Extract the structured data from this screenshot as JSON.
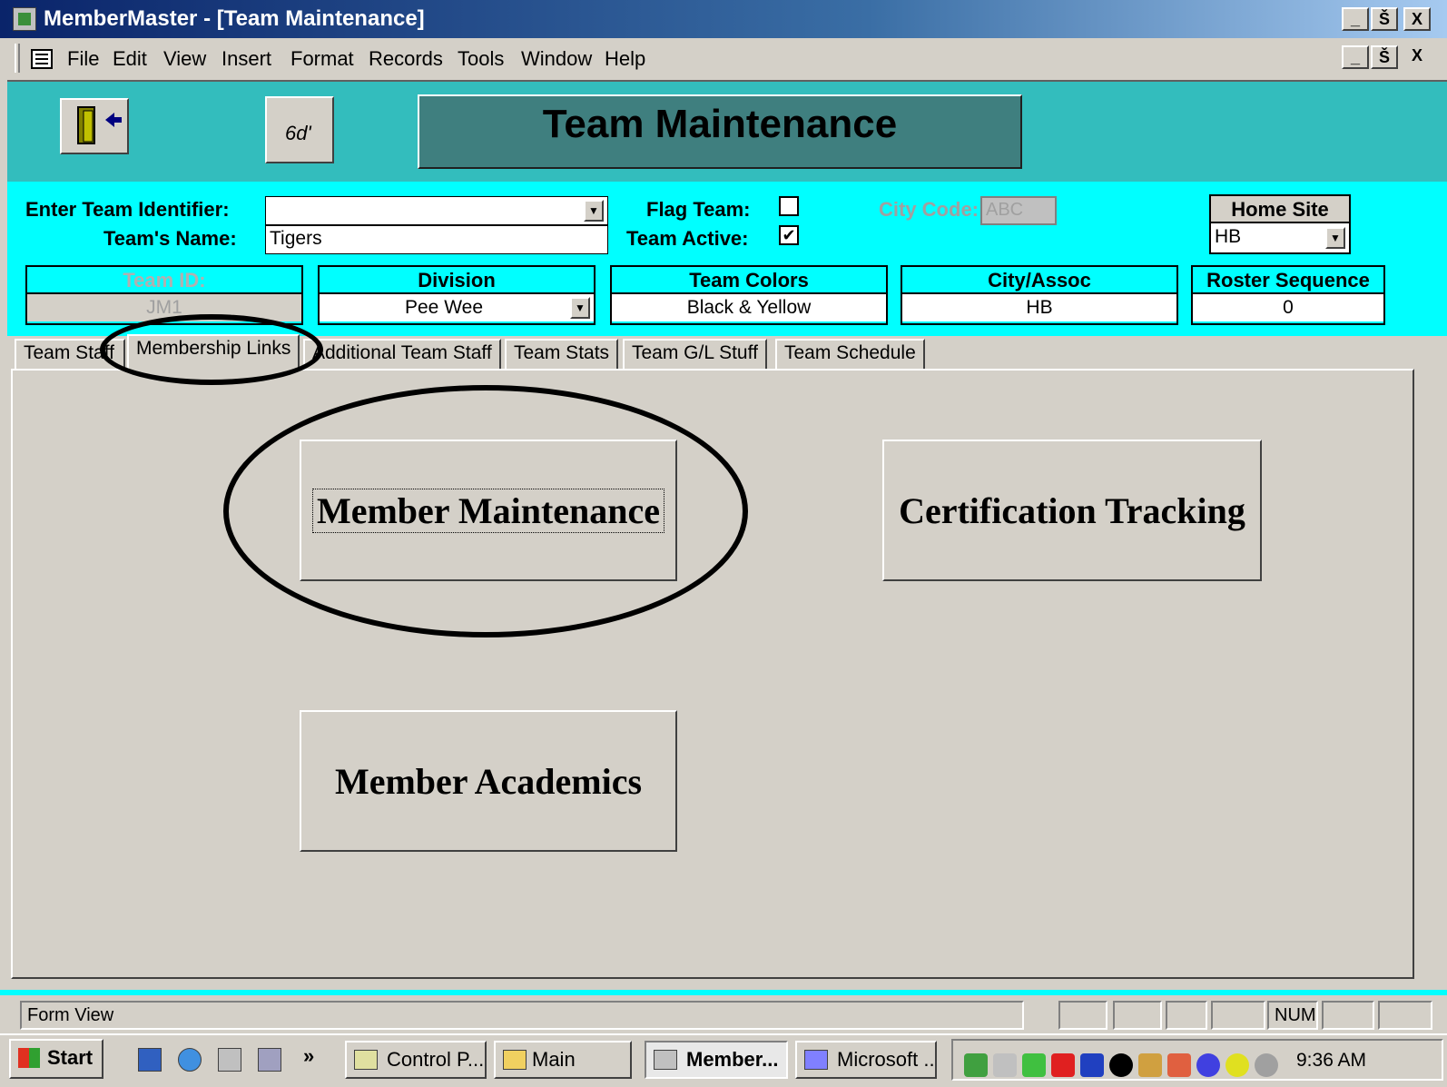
{
  "window": {
    "title": "MemberMaster - [Team Maintenance]",
    "controls": [
      "_",
      "Š",
      "X"
    ]
  },
  "menu": {
    "items": [
      "File",
      "Edit",
      "View",
      "Insert",
      "Format",
      "Records",
      "Tools",
      "Window",
      "Help"
    ],
    "doc_controls": [
      "_",
      "Š",
      "X"
    ]
  },
  "header": {
    "form_title": "Team Maintenance",
    "exit_icon": "door-exit-icon",
    "glasses_icon": "glasses-icon",
    "glasses_text": "6d'"
  },
  "fields": {
    "team_identifier_label": "Enter Team Identifier:",
    "team_identifier_value": "",
    "team_name_label": "Team's Name:",
    "team_name_value": "Tigers",
    "flag_team_label": "Flag Team:",
    "flag_team_checked": false,
    "team_active_label": "Team Active:",
    "team_active_checked": true,
    "check_mark": "✔",
    "city_code_label": "City Code:",
    "city_code_value": "ABC",
    "home_site_label": "Home Site",
    "home_site_value": "HB",
    "dropdown_arrow": "▼"
  },
  "columns": {
    "team_id": {
      "label": "Team ID:",
      "value": "JM1"
    },
    "division": {
      "label": "Division",
      "value": "Pee Wee"
    },
    "team_colors": {
      "label": "Team Colors",
      "value": "Black & Yellow"
    },
    "city_assoc": {
      "label": "City/Assoc",
      "value": "HB"
    },
    "roster_sequence": {
      "label": "Roster Sequence",
      "value": "0"
    }
  },
  "tabs": [
    {
      "label": "Team Staff"
    },
    {
      "label": "Membership Links",
      "active": true
    },
    {
      "label": "Additional Team Staff"
    },
    {
      "label": "Team Stats"
    },
    {
      "label": "Team G/L Stuff"
    },
    {
      "label": "Team Schedule"
    }
  ],
  "buttons": {
    "member_maintenance": "Member Maintenance",
    "certification_tracking": "Certification Tracking",
    "member_academics": "Member Academics"
  },
  "status": {
    "view": "Form View",
    "num": "NUM"
  },
  "taskbar": {
    "start": "Start",
    "chevron": "»",
    "tasks": [
      "Control P...",
      "Main",
      "Member...",
      "Microsoft ..."
    ],
    "active_task_index": 2,
    "time": "9:36 AM",
    "colors": {
      "teal_header": "#33bdbd",
      "cyan_fields": "#00ffff",
      "titlebar": "#0a246a",
      "face": "#d4d0c8"
    }
  }
}
